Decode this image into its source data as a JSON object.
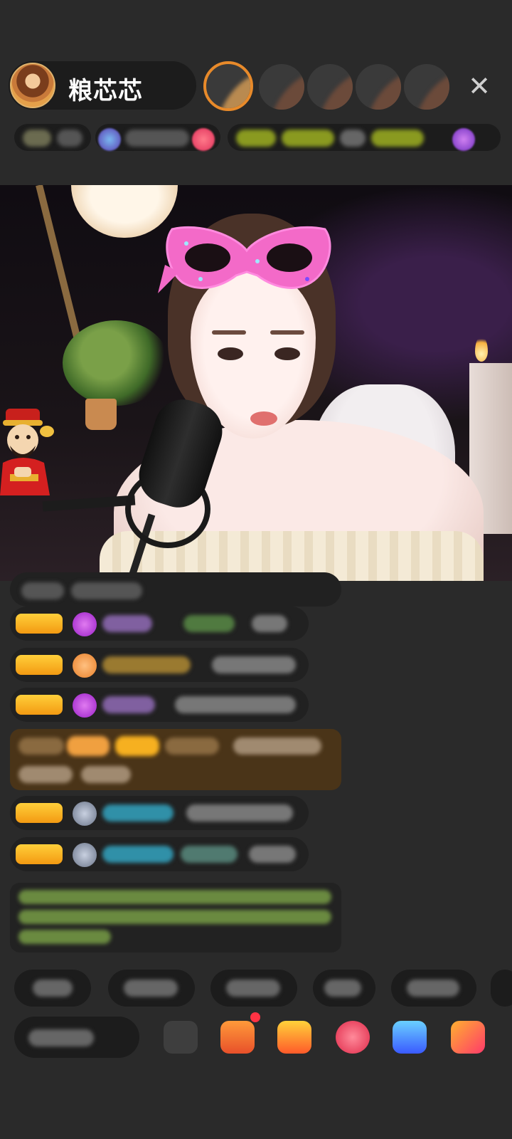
{
  "header": {
    "host_name": "粮芯芯",
    "close_icon": "✕",
    "tags": [
      "",
      "",
      "",
      "",
      ""
    ]
  },
  "overlay": {
    "mascot_icon": "fortune-god-icon",
    "mask_effect": "pink-cat-eye-mask"
  },
  "chat": {
    "system_message": "",
    "messages": [
      {
        "badge": "",
        "badge_color": "#f7b020",
        "icon_color": "#b13de0",
        "user": "",
        "user_color": "#c08ad8",
        "text": ""
      },
      {
        "badge": "",
        "badge_color": "#f7b020",
        "icon_color": "#f08a3a",
        "user": "",
        "user_color": "#e2b040",
        "text": ""
      },
      {
        "badge": "",
        "badge_color": "#f7b020",
        "icon_color": "#b13de0",
        "user": "",
        "user_color": "#c08ad8",
        "text": ""
      },
      {
        "badge": "",
        "badge_color": "#f7b020",
        "icon_color": "#9aa4b8",
        "user": "",
        "user_color": "#40b8d8",
        "text": ""
      },
      {
        "badge": "",
        "badge_color": "#f7b020",
        "icon_color": "#9aa4b8",
        "user": "",
        "user_color": "#40b8d8",
        "text": ""
      }
    ],
    "welcome_text": "",
    "notice_text": ""
  },
  "quick_replies": [
    "",
    "",
    "",
    "",
    ""
  ],
  "bottom_bar": {
    "say_placeholder": "",
    "icons": [
      "more-icon",
      "gift-box-icon",
      "gift-bag-icon",
      "heart-icon",
      "game-icon",
      "shop-icon"
    ]
  },
  "colors": {
    "background": "#2a2a2a",
    "badge_gold": "#f7b020",
    "notice_green": "#9fd36a",
    "welcome_brown": "#4a3418",
    "accent_red": "#ff3344"
  }
}
